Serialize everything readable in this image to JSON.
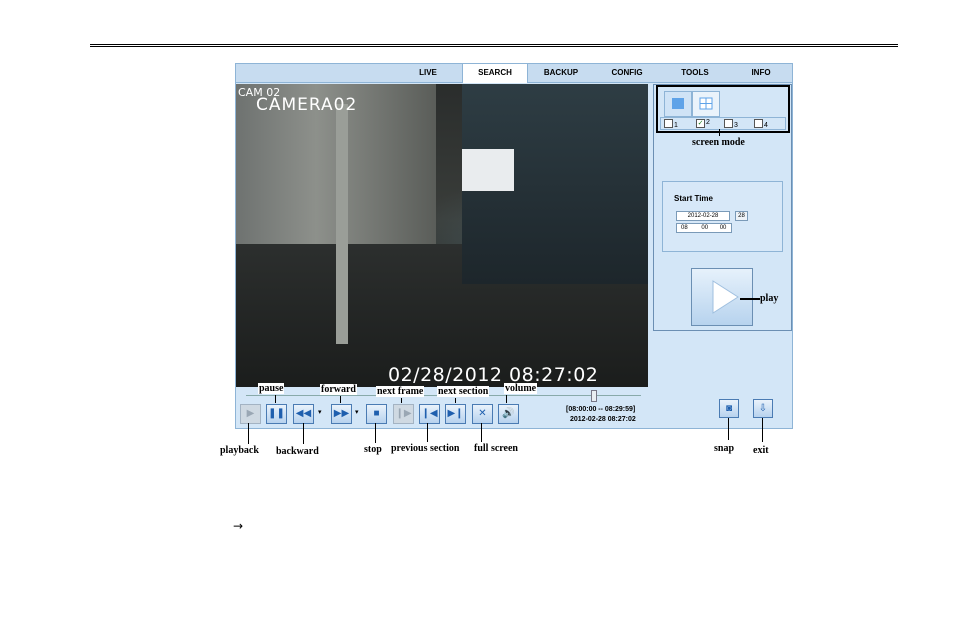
{
  "nav": {
    "tabs": [
      "LIVE",
      "SEARCH",
      "BACKUP",
      "CONFIG",
      "TOOLS",
      "INFO"
    ],
    "active": "SEARCH"
  },
  "video": {
    "channel_label": "CAM 02",
    "camera_name": "CAMERA02",
    "timestamp": "02/28/2012 08:27:02"
  },
  "screen_mode": {
    "channels": [
      "1",
      "2",
      "3",
      "4"
    ],
    "checked": "2",
    "check_mark": "✓"
  },
  "search": {
    "start_time_label": "Start Time",
    "date": "2012-02-28",
    "calendar_day": "28",
    "hour": "08",
    "minute": "00",
    "second": "00"
  },
  "playback": {
    "range": "[08:00:00 -- 08:29:59]",
    "current": "2012-02-28 08:27:02",
    "progress": 0.88
  },
  "annotations": {
    "pause": "pause",
    "forward": "forward",
    "next_frame": "next frame",
    "next_section": "next section",
    "volume": "volume",
    "playback": "playback",
    "backward": "backward",
    "stop": "stop",
    "previous_section": "previous section",
    "full_screen": "full screen",
    "snap": "snap",
    "exit": "exit",
    "screen_mode": "screen mode",
    "play": "play"
  },
  "note_symbol": "→",
  "icons": {
    "playback": "play-icon",
    "pause": "pause-icon",
    "backward": "rewind-icon",
    "forward": "fast-forward-icon",
    "stop": "stop-icon",
    "next_frame": "step-forward-icon",
    "previous_section": "skip-back-icon",
    "next_section": "skip-forward-icon",
    "full_screen": "fullscreen-icon",
    "volume": "speaker-icon",
    "snap": "camera-icon",
    "exit": "exit-icon"
  }
}
